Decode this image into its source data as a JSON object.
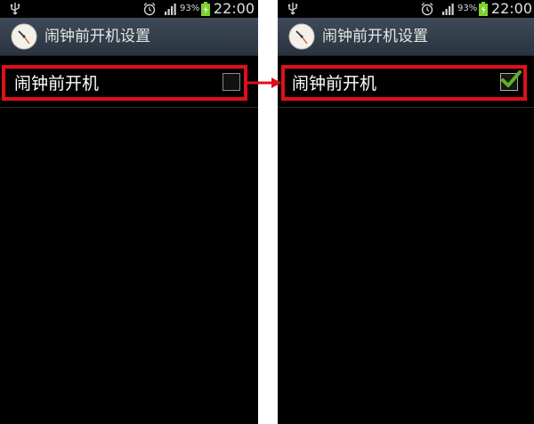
{
  "panels": [
    {
      "status": {
        "battery_percent": "93%",
        "time": "22:00"
      },
      "title": "闹钟前开机设置",
      "setting": {
        "label": "闹钟前开机",
        "checked": false
      }
    },
    {
      "status": {
        "battery_percent": "93%",
        "time": "22:00"
      },
      "title": "闹钟前开机设置",
      "setting": {
        "label": "闹钟前开机",
        "checked": true
      }
    }
  ],
  "colors": {
    "highlight": "#e01018",
    "title_bar": "#34404c",
    "check_green": "#5ab51c",
    "battery_green": "#7cd12c"
  },
  "icons": [
    "usb-icon",
    "alarm-icon",
    "signal-icon",
    "battery-icon",
    "clock-app-icon",
    "checkmark-icon",
    "arrow-icon"
  ]
}
